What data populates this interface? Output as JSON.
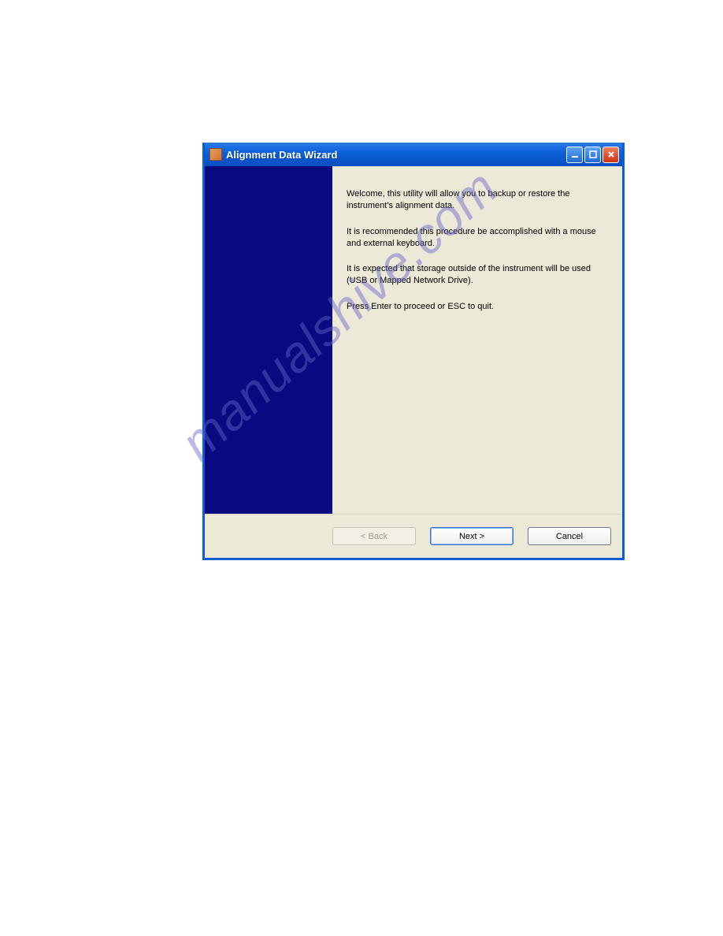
{
  "window": {
    "title": "Alignment Data Wizard"
  },
  "content": {
    "p1": "Welcome, this utility will allow you to backup or restore the instrument's alignment data.",
    "p2": "It is recommended this procedure be accomplished with a mouse and external keyboard.",
    "p3": "It is expected that storage outside of the instrument will be used (USB or Mapped Network Drive).",
    "p4": "Press Enter to proceed or ESC to quit."
  },
  "buttons": {
    "back": "< Back",
    "next": "Next >",
    "cancel": "Cancel"
  },
  "watermark": "manualshive.com"
}
